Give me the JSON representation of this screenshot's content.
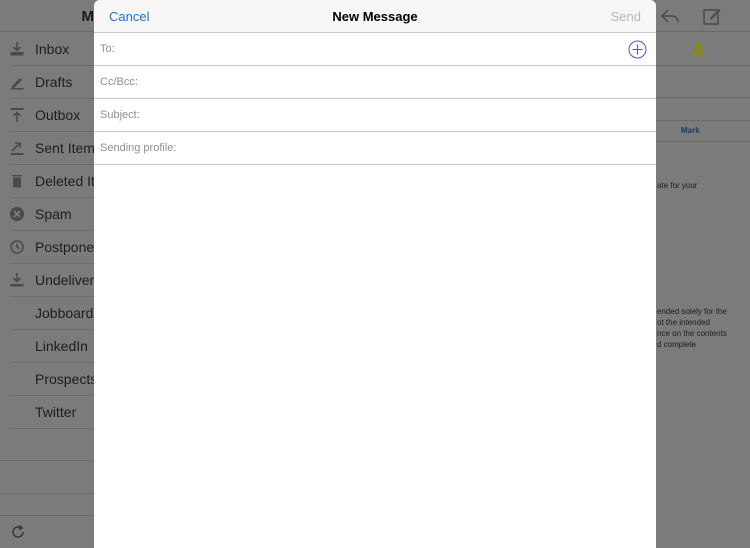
{
  "sidebar": {
    "header_title": "M",
    "folders": [
      {
        "label": "Inbox",
        "icon": "inbox-icon"
      },
      {
        "label": "Drafts",
        "icon": "drafts-icon"
      },
      {
        "label": "Outbox",
        "icon": "outbox-icon"
      },
      {
        "label": "Sent Items",
        "icon": "sent-icon"
      },
      {
        "label": "Deleted Ite",
        "icon": "trash-icon"
      },
      {
        "label": "Spam",
        "icon": "spam-icon"
      },
      {
        "label": "Postponed",
        "icon": "postponed-icon"
      },
      {
        "label": "Undelivere",
        "icon": "undelivered-icon"
      },
      {
        "label": "Jobboards",
        "icon": ""
      },
      {
        "label": "LinkedIn",
        "icon": ""
      },
      {
        "label": "Prospects",
        "icon": ""
      },
      {
        "label": "Twitter",
        "icon": ""
      }
    ]
  },
  "right_pane": {
    "mark_label": "Mark",
    "text_lines": [
      "ate for your",
      "ended solely for the",
      "ot the intended",
      "nce on the contents",
      "d complete"
    ]
  },
  "compose": {
    "title": "New Message",
    "cancel_label": "Cancel",
    "send_label": "Send",
    "fields": {
      "to": {
        "label": "To:",
        "value": ""
      },
      "cc_bcc": {
        "label": "Cc/Bcc:",
        "value": ""
      },
      "subject": {
        "label": "Subject:",
        "value": ""
      },
      "sending_profile": {
        "label": "Sending profile:",
        "value": ""
      }
    },
    "body": ""
  },
  "colors": {
    "accent": "#1e73c8",
    "send_disabled": "#b7b7b7",
    "overlay": "#7b7b7b"
  }
}
